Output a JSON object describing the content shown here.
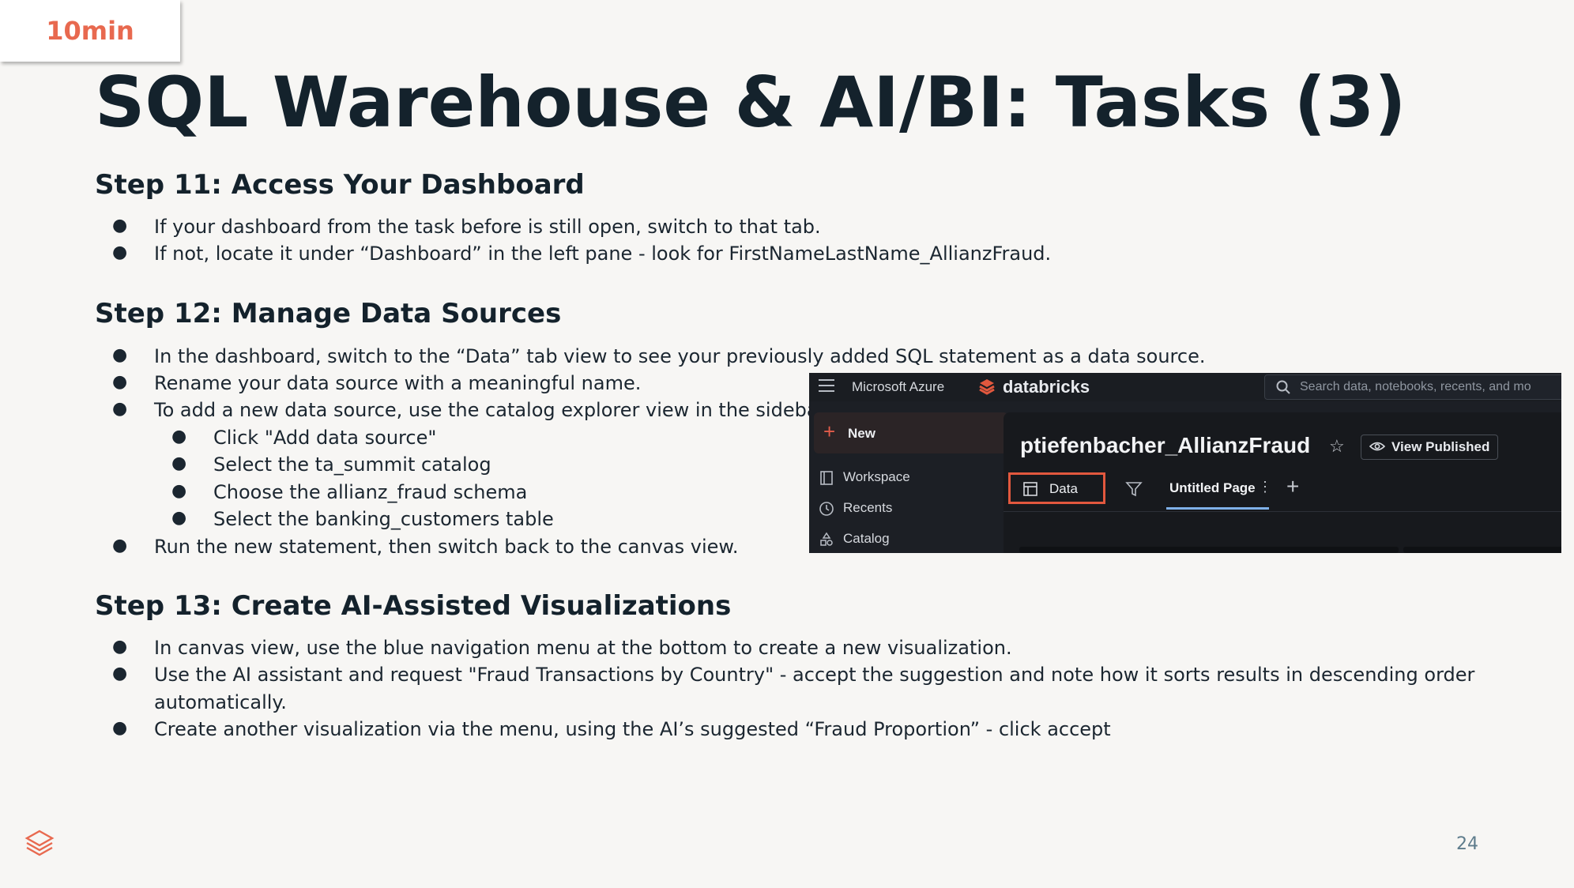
{
  "badge": "10min",
  "title": "SQL Warehouse & AI/BI: Tasks (3)",
  "sections": [
    {
      "heading": "Step 11: Access Your Dashboard",
      "bullets": [
        "If your dashboard from the task before is still open, switch to that tab.",
        "If not, locate it under “Dashboard” in the left pane -  look for FirstNameLastName_AllianzFraud."
      ]
    },
    {
      "heading": "Step 12: Manage Data Sources",
      "bullets": [
        "In the dashboard, switch to the “Data” tab view to see your previously added SQL statement as a data source.",
        "Rename your data source with a meaningful name.",
        "To add a new data source, use the catalog explorer view in the sidebar.",
        "Run the new statement, then switch back to the canvas view."
      ],
      "sub_bullets": [
        "Click \"Add data source\"",
        "Select the ta_summit catalog",
        "Choose the allianz_fraud schema",
        "Select the banking_customers table"
      ]
    },
    {
      "heading": "Step 13: Create AI-Assisted Visualizations",
      "bullets": [
        "In canvas view, use the blue navigation menu at the bottom to create a new visualization.",
        "Use the AI assistant and request \"Fraud Transactions by Country\" - accept the suggestion and note how it sorts results in descending order",
        "automatically.",
        "Create another visualization via the menu, using the AI’s suggested “Fraud Proportion” - click accept"
      ]
    }
  ],
  "bullet_char": "●",
  "screenshot": {
    "brand": "Microsoft Azure",
    "product": "databricks",
    "search_placeholder": "Search data, notebooks, recents, and mo",
    "new_label": "New",
    "nav": [
      "Workspace",
      "Recents",
      "Catalog"
    ],
    "dashboard_name": "ptiefenbacher_AllianzFraud",
    "view_published": "View Published",
    "tab_data": "Data",
    "tab_page": "Untitled Page",
    "star": "☆",
    "kebab": "⋮",
    "add": "+"
  },
  "page_number": "24",
  "colors": {
    "accent": "#e8694f",
    "title": "#14222c",
    "highlight_box": "#e2583e",
    "page_number": "#5e7c8c"
  }
}
